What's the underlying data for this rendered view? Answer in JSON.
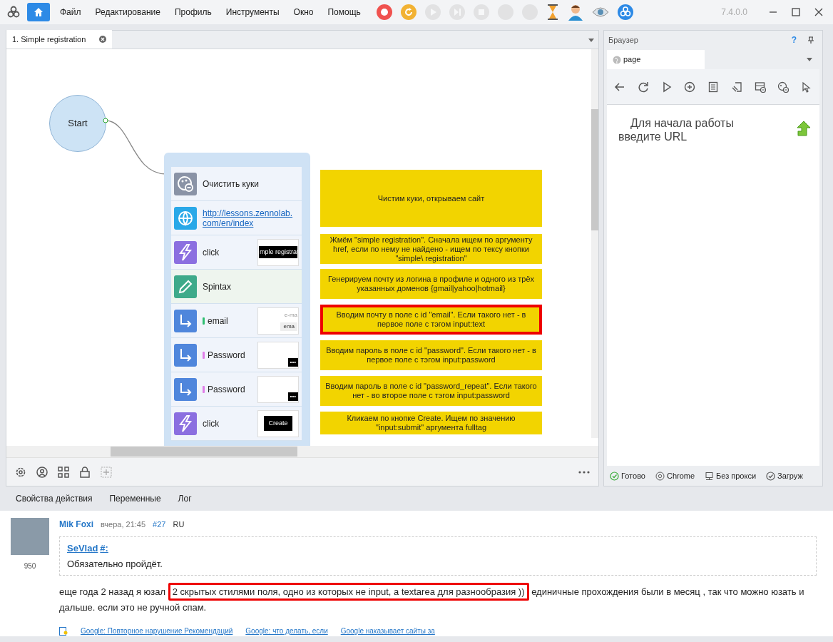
{
  "menu": [
    "Файл",
    "Редактирование",
    "Профиль",
    "Инструменты",
    "Окно",
    "Помощь"
  ],
  "toolbar": [
    {
      "kind": "record",
      "disabled": false
    },
    {
      "kind": "restart",
      "disabled": false
    },
    {
      "kind": "play",
      "disabled": true
    },
    {
      "kind": "step",
      "disabled": true
    },
    {
      "kind": "stop",
      "disabled": true
    },
    {
      "kind": "blank",
      "disabled": true
    },
    {
      "kind": "blank",
      "disabled": true
    },
    {
      "kind": "hourglass",
      "disabled": false
    },
    {
      "kind": "person",
      "disabled": false
    },
    {
      "kind": "eye",
      "disabled": false
    },
    {
      "kind": "logo",
      "disabled": false
    }
  ],
  "version": "7.4.0.0",
  "project_tab": {
    "label": "1. Simple registration",
    "selected": true
  },
  "canvas": {
    "start": "Start",
    "actions": [
      {
        "kind": "cookies",
        "label": "Очистить куки"
      },
      {
        "kind": "url",
        "label": "http://lessons.zennolab.com/en/index"
      },
      {
        "kind": "click",
        "label": "click",
        "thumb": "mple registrat"
      },
      {
        "kind": "spintax",
        "label": "Spintax"
      },
      {
        "kind": "input",
        "label": "email",
        "color": "#2fbf71",
        "thumb": "e-ma",
        "thumb_2": "ema"
      },
      {
        "kind": "input",
        "label": "Password",
        "color": "#e07ee8",
        "thumb": "•••"
      },
      {
        "kind": "input",
        "label": "Password",
        "color": "#e07ee8",
        "thumb": "•••"
      },
      {
        "kind": "click",
        "label": "click",
        "button": "Create"
      }
    ],
    "notes": [
      {
        "text": "Чистим куки, открываем сайт",
        "highlighted": false
      },
      {
        "text": "Жмём \"simple registration\". Сначала ищем по аргументу href, если по нему не найдено - ищем по тексу кнопки \"simple\\ registration\"",
        "highlighted": false
      },
      {
        "text": "Генерируем почту из логина в профиле и одного из трёх указанных доменов {gmail|yahoo|hotmail}",
        "highlighted": false
      },
      {
        "text": "Вводим почту в поле с id \"email\". Если такого нет - в первое поле с тэгом input:text",
        "highlighted": true
      },
      {
        "text": "Вводим пароль в поле с id \"password\". Если такого нет - в первое поле с тэгом input:password",
        "highlighted": false
      },
      {
        "text": "Вводим пароль в поле с id \"password_repeat\". Если такого нет - во второе поле с тэгом input:password",
        "highlighted": false
      },
      {
        "text": "Кликаем по кнопке Create. Ищем по значению \"input:submit\" аргумента fulltag",
        "highlighted": false
      }
    ]
  },
  "bottom_tabs": [
    "Свойства действия",
    "Переменные",
    "Лог"
  ],
  "browser": {
    "title": "Браузер",
    "help": "?",
    "tab": "page",
    "message": "Для начала работы введите URL",
    "status": [
      {
        "kind": "ok",
        "label": "Готово"
      },
      {
        "kind": "browser",
        "label": "Chrome"
      },
      {
        "kind": "proxy",
        "label": "Без прокси"
      },
      {
        "kind": "ok",
        "label": "Загруж"
      }
    ]
  },
  "post": {
    "author": "Mik Foxi",
    "time": "вчера, 21:45",
    "number": "#27",
    "lang": "RU",
    "score": "950",
    "quote_author": "SeVlad",
    "quote_link": "#:",
    "quote_text": "Обязательно пройдёт.",
    "body_before": "еще года 2 назад я юзал",
    "body_boxed": "2 скрытых стилями поля, одно из которых не input, а textarea для разнообразия ))",
    "body_after": "единичные прохождения были в месяц , так что можно юзать и дальше. если это не ручной спам.",
    "links": [
      "Google: Повторное нарушение Рекомендаций",
      "Google: что делать, если",
      "Google наказывает сайты за"
    ]
  }
}
